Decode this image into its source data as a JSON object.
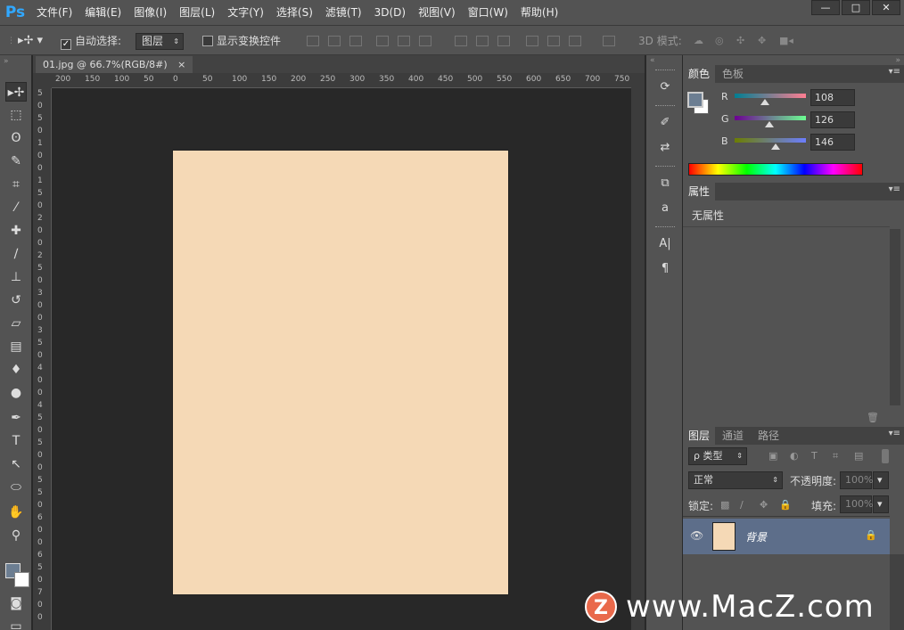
{
  "app": {
    "logo": "Ps"
  },
  "menu": [
    "文件(F)",
    "编辑(E)",
    "图像(I)",
    "图层(L)",
    "文字(Y)",
    "选择(S)",
    "滤镜(T)",
    "3D(D)",
    "视图(V)",
    "窗口(W)",
    "帮助(H)"
  ],
  "window_controls": {
    "minimize": "—",
    "maximize": "□",
    "close": "✕"
  },
  "options": {
    "auto_select_label": "自动选择:",
    "auto_select_checked": "✓",
    "auto_select_target": "图层",
    "show_transform_label": "显示变换控件",
    "mode_3d_label": "3D 模式:"
  },
  "document": {
    "tab_title": "01.jpg @ 66.7%(RGB/8#)",
    "tab_close": "×",
    "image_color": "#f5d9b6"
  },
  "hruler_ticks": [
    "200",
    "150",
    "100",
    "50",
    "0",
    "50",
    "100",
    "150",
    "200",
    "250",
    "300",
    "350",
    "400",
    "450",
    "500",
    "550",
    "600",
    "650",
    "700",
    "750"
  ],
  "vruler_ticks": [
    "5",
    "0",
    "5",
    "0",
    "1",
    "0",
    "0",
    "1",
    "5",
    "0",
    "2",
    "0",
    "0",
    "2",
    "5",
    "0",
    "3",
    "0",
    "0",
    "3",
    "5",
    "0",
    "4",
    "0",
    "0",
    "4",
    "5",
    "0",
    "5",
    "0",
    "0",
    "5",
    "5",
    "0",
    "6",
    "0",
    "0",
    "6",
    "5",
    "0",
    "7",
    "0",
    "0"
  ],
  "color_panel": {
    "tabs": [
      "颜色",
      "色板"
    ],
    "foreground": "#6c7e92",
    "channels": [
      {
        "label": "R",
        "value": "108",
        "ratio": 0.42
      },
      {
        "label": "G",
        "value": "126",
        "ratio": 0.49
      },
      {
        "label": "B",
        "value": "146",
        "ratio": 0.57
      }
    ]
  },
  "properties_panel": {
    "tab": "属性",
    "content": "无属性"
  },
  "layers_panel": {
    "tabs": [
      "图层",
      "通道",
      "路径"
    ],
    "filter_label": "ρ 类型",
    "blend_mode": "正常",
    "opacity_label": "不透明度:",
    "opacity_value": "100%",
    "lock_label": "锁定:",
    "fill_label": "填充:",
    "fill_value": "100%",
    "layers": [
      {
        "name": "背景",
        "visible": "👁",
        "locked": "🔒"
      }
    ]
  },
  "watermark": {
    "icon": "Z",
    "text": "www.MacZ.com"
  }
}
